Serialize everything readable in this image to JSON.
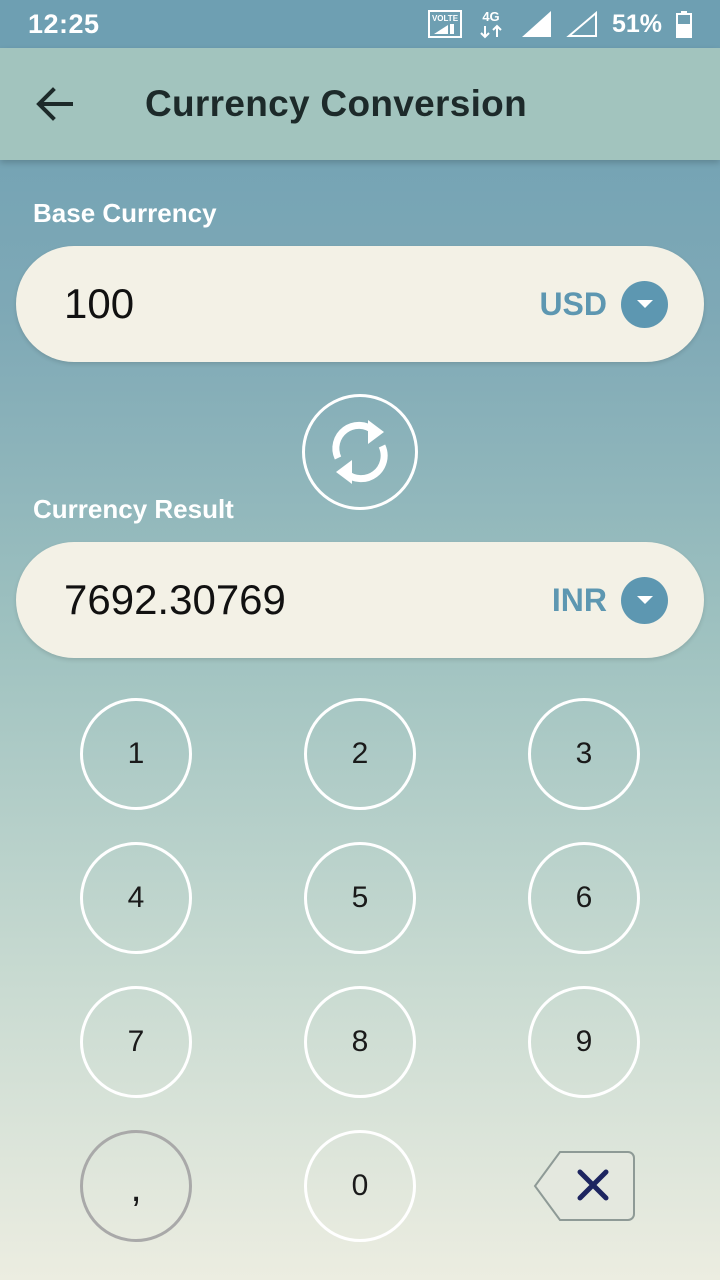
{
  "status_bar": {
    "time": "12:25",
    "volte": "VOLTE",
    "network": "4G",
    "battery": "51%"
  },
  "app_bar": {
    "title": "Currency Conversion"
  },
  "base": {
    "label": "Base Currency",
    "value": "100",
    "currency": "USD"
  },
  "result": {
    "label": "Currency Result",
    "value": "7692.30769",
    "currency": "INR"
  },
  "keypad": {
    "keys": [
      "1",
      "2",
      "3",
      "4",
      "5",
      "6",
      "7",
      "8",
      "9",
      ",",
      "0"
    ]
  },
  "colors": {
    "accent": "#5d97b1",
    "app_bar": "#a2c4be",
    "status_bar": "#6e9fb2",
    "field_bg": "#f3f1e6"
  }
}
